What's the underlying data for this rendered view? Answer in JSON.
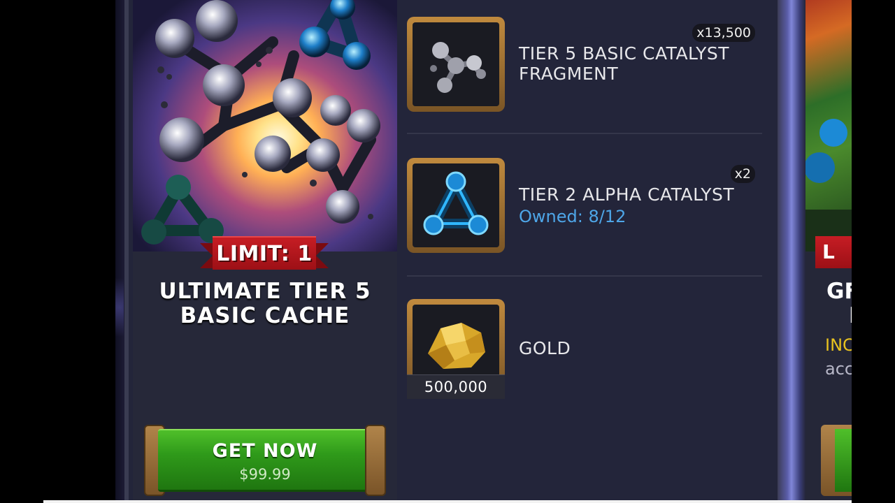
{
  "offer": {
    "limit_label": "LIMIT: 1",
    "title_line1": "ULTIMATE TIER 5",
    "title_line2": "BASIC CACHE",
    "button_label": "GET NOW",
    "price": "$99.99",
    "colors": {
      "ribbon": "#c61d24",
      "button": "#2f9a1a"
    }
  },
  "rewards": [
    {
      "name_line1": "TIER 5 BASIC CATALYST",
      "name_line2": "FRAGMENT",
      "quantity": "x13,500",
      "icon": "tier5-basic-catalyst-fragment-icon"
    },
    {
      "name": "TIER 2 ALPHA CATALYST",
      "quantity": "x2",
      "owned": "Owned: 8/12",
      "icon": "tier2-alpha-catalyst-icon"
    },
    {
      "name": "GOLD",
      "quantity": "500,000",
      "icon": "gold-nugget-icon"
    }
  ],
  "next_offer": {
    "limit_partial": "L",
    "title_partial_line1": "GF",
    "title_partial_line2": "I",
    "sub1_partial": "INC",
    "sub2_partial": "acc"
  }
}
